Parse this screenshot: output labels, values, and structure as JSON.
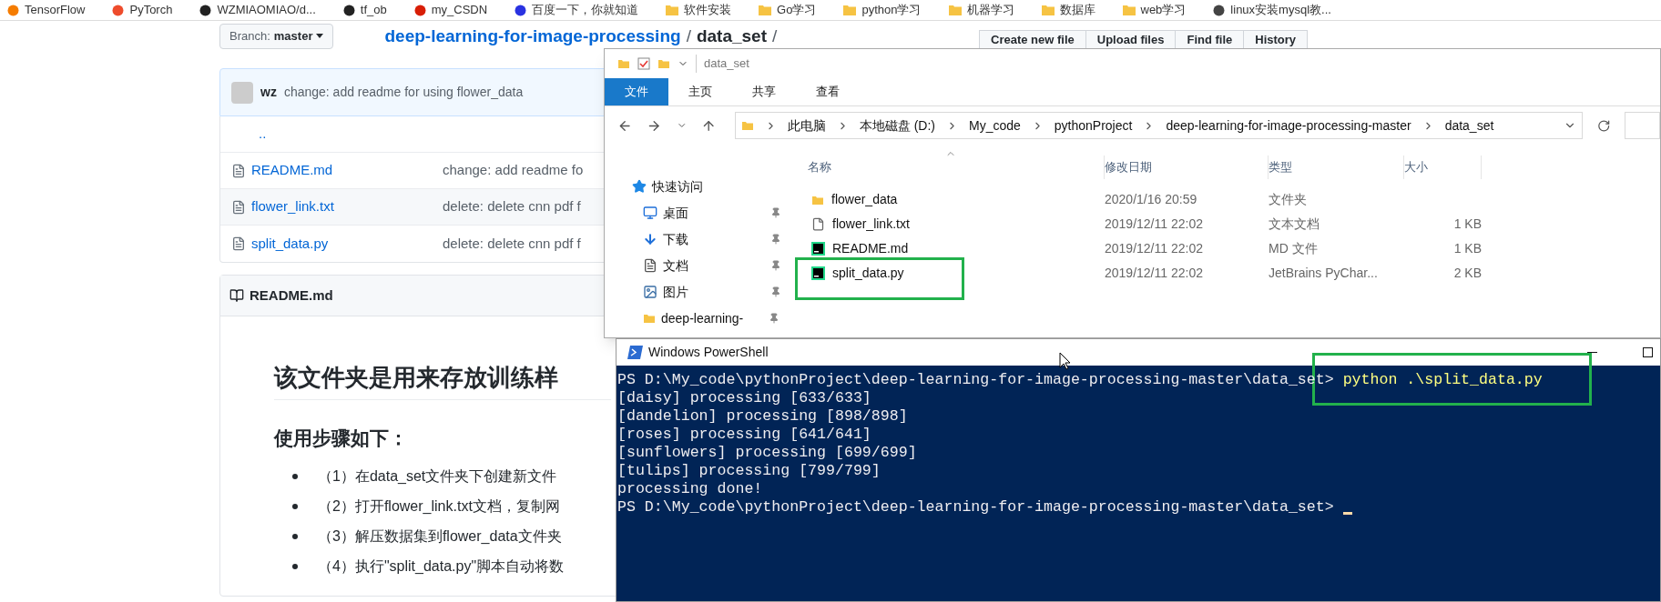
{
  "bookmarks": [
    {
      "label": "TensorFlow",
      "kind": "site",
      "color": "#f57c00"
    },
    {
      "label": "PyTorch",
      "kind": "site",
      "color": "#ee4c2c"
    },
    {
      "label": "WZMIAOMIAO/d...",
      "kind": "site",
      "color": "#222222"
    },
    {
      "label": "tf_ob",
      "kind": "site",
      "color": "#222222"
    },
    {
      "label": "my_CSDN",
      "kind": "site",
      "color": "#d81e06"
    },
    {
      "label": "百度一下，你就知道",
      "kind": "site",
      "color": "#2932e1"
    },
    {
      "label": "软件安装",
      "kind": "folder",
      "color": "#f6c343"
    },
    {
      "label": "Go学习",
      "kind": "folder",
      "color": "#f6c343"
    },
    {
      "label": "python学习",
      "kind": "folder",
      "color": "#f6c343"
    },
    {
      "label": "机器学习",
      "kind": "folder",
      "color": "#f6c343"
    },
    {
      "label": "数据库",
      "kind": "folder",
      "color": "#f6c343"
    },
    {
      "label": "web学习",
      "kind": "folder",
      "color": "#f6c343"
    },
    {
      "label": "linux安装mysql教...",
      "kind": "site",
      "color": "#444444"
    }
  ],
  "github": {
    "branch_label": "Branch:",
    "branch": "master",
    "repo": "deep-learning-for-image-processing",
    "separator": "/",
    "folder": "data_set",
    "trail": "/",
    "actions": [
      "Create new file",
      "Upload files",
      "Find file",
      "History"
    ],
    "commit": {
      "author": "wz",
      "message": "change: add readme for using flower_data"
    },
    "parent_link": "..",
    "files": [
      {
        "name": "README.md",
        "message": "change: add readme fo"
      },
      {
        "name": "flower_link.txt",
        "message": "delete: delete cnn pdf f"
      },
      {
        "name": "split_data.py",
        "message": "delete: delete cnn pdf f"
      }
    ],
    "readme_title": "README.md",
    "readme": {
      "heading": "该文件夹是用来存放训练样",
      "subheading": "使用步骤如下：",
      "steps": [
        "（1）在data_set文件夹下创建新文件",
        "（2）打开flower_link.txt文档，复制网",
        "（3）解压数据集到flower_data文件夹",
        "（4）执行\"split_data.py\"脚本自动将数"
      ]
    }
  },
  "explorer": {
    "title": "data_set",
    "ribbon_tabs": [
      {
        "label": "文件",
        "selected": true
      },
      {
        "label": "主页",
        "selected": false
      },
      {
        "label": "共享",
        "selected": false
      },
      {
        "label": "查看",
        "selected": false
      }
    ],
    "path": [
      "此电脑",
      "本地磁盘 (D:)",
      "My_code",
      "pythonProject",
      "deep-learning-for-image-processing-master",
      "data_set"
    ],
    "nav": [
      {
        "label": "快速访问",
        "kind": "star",
        "pinned": false
      },
      {
        "label": "桌面",
        "kind": "desktop",
        "pinned": true
      },
      {
        "label": "下载",
        "kind": "download",
        "pinned": true
      },
      {
        "label": "文档",
        "kind": "document",
        "pinned": true
      },
      {
        "label": "图片",
        "kind": "picture",
        "pinned": true
      },
      {
        "label": "deep-learning-",
        "kind": "folder",
        "pinned": true
      }
    ],
    "columns": [
      "名称",
      "修改日期",
      "类型",
      "大小"
    ],
    "files": [
      {
        "name": "flower_data",
        "modified": "2020/1/16 20:59",
        "type": "文件夹",
        "kind": "folder",
        "highlighted": false
      },
      {
        "name": "flower_link.txt",
        "modified": "2019/12/11 22:02",
        "type": "文本文档",
        "size": "1 KB",
        "kind": "text",
        "highlighted": false
      },
      {
        "name": "README.md",
        "modified": "2019/12/11 22:02",
        "type": "MD 文件",
        "size": "1 KB",
        "kind": "pycharm",
        "highlighted": false
      },
      {
        "name": "split_data.py",
        "modified": "2019/12/11 22:02",
        "type": "JetBrains PyChar...",
        "size": "2 KB",
        "kind": "pycharm",
        "highlighted": true
      }
    ]
  },
  "powershell": {
    "title": "Windows PowerShell",
    "lines": [
      {
        "kind": "prompt",
        "text": "PS D:\\My_code\\pythonProject\\deep-learning-for-image-processing-master\\data_set> ",
        "command": "python .\\split_data.py",
        "highlighted": true
      },
      {
        "kind": "output",
        "text": "[daisy] processing [633/633]"
      },
      {
        "kind": "output",
        "text": "[dandelion] processing [898/898]"
      },
      {
        "kind": "output",
        "text": "[roses] processing [641/641]"
      },
      {
        "kind": "output",
        "text": "[sunflowers] processing [699/699]"
      },
      {
        "kind": "output",
        "text": "[tulips] processing [799/799]"
      },
      {
        "kind": "output",
        "text": "processing done!"
      },
      {
        "kind": "prompt",
        "text": "PS D:\\My_code\\pythonProject\\deep-learning-for-image-processing-master\\data_set> ",
        "cursor": true
      }
    ]
  }
}
